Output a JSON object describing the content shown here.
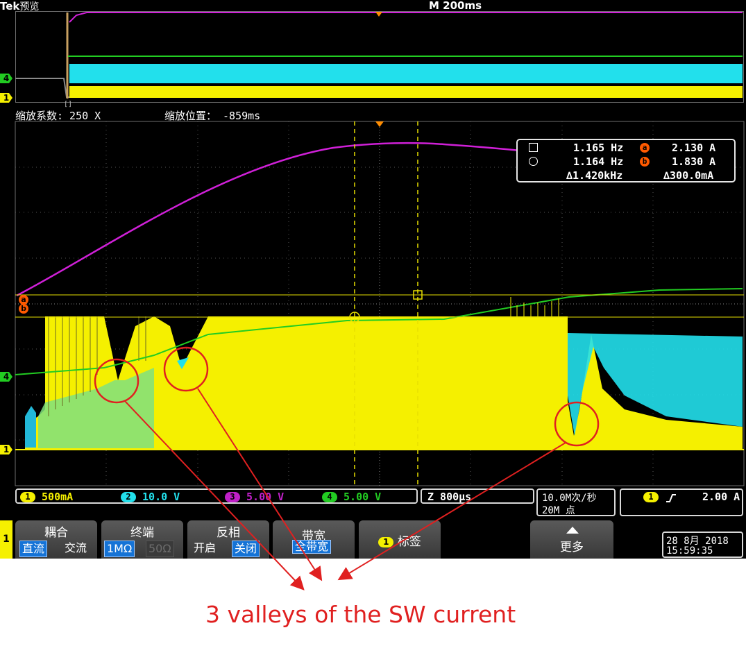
{
  "header": {
    "brand": "Tek",
    "mode": "预览",
    "timebase": "M 200ms",
    "zoom_factor": "缩放系数: 250 X",
    "zoom_position": "缩放位置： -859ms"
  },
  "channel_markers": {
    "ch4": "4",
    "ch1": "1"
  },
  "cursor_badges": {
    "a": "a",
    "b": "b"
  },
  "measurement_readout": {
    "freq_square": "1.165 Hz",
    "freq_circle": "1.164 Hz",
    "delta_freq": "∆1.420kHz",
    "cursor_a": "2.130 A",
    "cursor_b": "1.830 A",
    "delta_value": "∆300.0mA"
  },
  "status_bar": {
    "channels": [
      {
        "num": "1",
        "scale": "500mA",
        "color": "#f5f000"
      },
      {
        "num": "2",
        "scale": "10.0 V",
        "color": "#22e0ec"
      },
      {
        "num": "3",
        "scale": "5.00 V",
        "color": "#c020c8"
      },
      {
        "num": "4",
        "scale": "5.00 V",
        "color": "#22cc22"
      }
    ],
    "zoom": "Z 800µs",
    "sample_rate": "10.0M次/秒",
    "record_length": "20M 点",
    "trigger_channel": "1",
    "trigger_level": "2.00 A"
  },
  "menu": {
    "active_channel": "1",
    "coupling": {
      "title": "耦合",
      "options": [
        "直流",
        "交流"
      ],
      "selected": "直流"
    },
    "termination": {
      "title": "终端",
      "options": [
        "1MΩ",
        "50Ω"
      ],
      "selected": "1MΩ"
    },
    "invert": {
      "title": "反相",
      "options": [
        "开启",
        "关闭"
      ],
      "selected": "关闭"
    },
    "bandwidth": {
      "title": "带宽",
      "value": "全带宽"
    },
    "label": {
      "chip": "1",
      "text": "标签"
    },
    "more": "更多"
  },
  "datetime": {
    "date": "28 8月 2018",
    "time": "15:59:35"
  },
  "annotation": {
    "caption": "3 valleys of the SW current",
    "color": "#e02020"
  },
  "colors": {
    "ch1": "#f5f000",
    "ch2": "#22e0ec",
    "ch3": "#d020d8",
    "ch4": "#22cc22",
    "cursor": "#ff5a00"
  }
}
